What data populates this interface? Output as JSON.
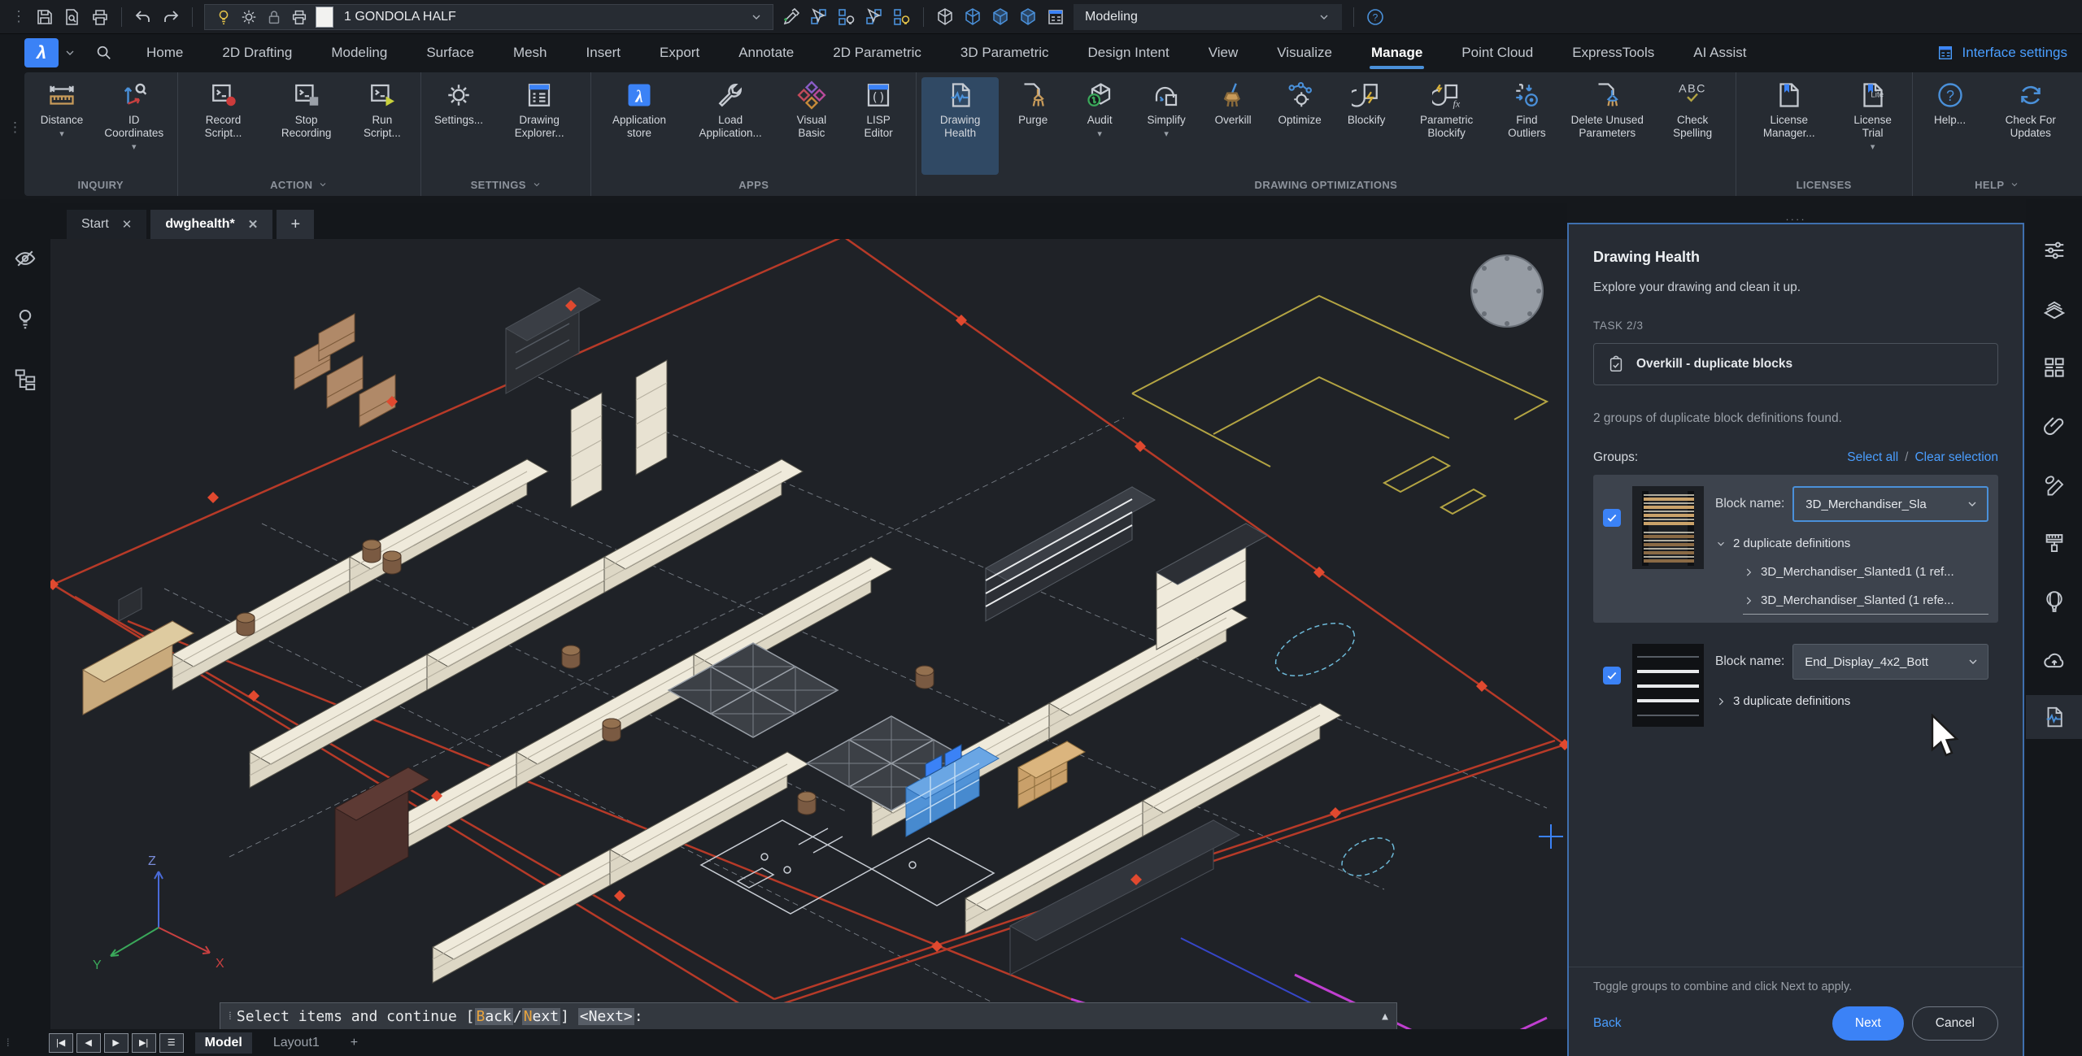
{
  "topbar": {
    "drawing_selector": {
      "value": "1 GONDOLA HALF"
    },
    "workspace_selector": {
      "value": "Modeling"
    },
    "icons": [
      "save-icon",
      "file-search-icon",
      "plot-icon",
      "undo-icon",
      "redo-icon",
      "bulb-icon",
      "sun-icon",
      "lock-icon",
      "printer-icon",
      "color-swatch",
      "eyedropper-icon",
      "select-similar-icon",
      "isolate-objects-icon",
      "deselect-icon",
      "unisolate-objects-icon",
      "wireframe-cube-icon",
      "hidden-cube-icon",
      "shaded-cube-icon",
      "realistic-cube-icon",
      "workspace-icon",
      "help-icon"
    ]
  },
  "tab_row": {
    "tabs": [
      "Home",
      "2D Drafting",
      "Modeling",
      "Surface",
      "Mesh",
      "Insert",
      "Export",
      "Annotate",
      "2D Parametric",
      "3D Parametric",
      "Design Intent",
      "View",
      "Visualize",
      "Manage",
      "Point Cloud",
      "ExpressTools",
      "AI Assist"
    ],
    "active_tab": "Manage",
    "interface_settings_label": "Interface settings"
  },
  "ribbon": {
    "groups": [
      {
        "label": "INQUIRY",
        "chevron": false,
        "items": [
          {
            "label": "Distance",
            "dropdown": true
          },
          {
            "label": "ID Coordinates",
            "dropdown": true
          }
        ]
      },
      {
        "label": "ACTION",
        "chevron": true,
        "items": [
          {
            "label": "Record Script..."
          },
          {
            "label": "Stop Recording"
          },
          {
            "label": "Run Script..."
          }
        ]
      },
      {
        "label": "SETTINGS",
        "chevron": true,
        "items": [
          {
            "label": "Settings..."
          },
          {
            "label": "Drawing Explorer..."
          }
        ]
      },
      {
        "label": "APPS",
        "chevron": false,
        "items": [
          {
            "label": "Application store"
          },
          {
            "label": "Load Application..."
          },
          {
            "label": "Visual Basic"
          },
          {
            "label": "LISP Editor"
          }
        ]
      },
      {
        "label": "DRAWING OPTIMIZATIONS",
        "chevron": false,
        "items": [
          {
            "label": "Drawing Health",
            "active": true
          },
          {
            "label": "Purge"
          },
          {
            "label": "Audit",
            "dropdown": true
          },
          {
            "label": "Simplify",
            "dropdown": true
          },
          {
            "label": "Overkill"
          },
          {
            "label": "Optimize"
          },
          {
            "label": "Blockify"
          },
          {
            "label": "Parametric Blockify"
          },
          {
            "label": "Find Outliers"
          },
          {
            "label": "Delete Unused Parameters"
          },
          {
            "label": "Check Spelling"
          }
        ]
      },
      {
        "label": "LICENSES",
        "chevron": false,
        "items": [
          {
            "label": "License Manager..."
          },
          {
            "label": "License Trial",
            "dropdown": true
          }
        ]
      },
      {
        "label": "HELP",
        "chevron": true,
        "items": [
          {
            "label": "Help..."
          },
          {
            "label": "Check For Updates"
          }
        ]
      }
    ]
  },
  "doc_tabs": {
    "tabs": [
      {
        "label": "Start"
      },
      {
        "label": "dwghealth*",
        "active": true
      }
    ],
    "close_glyph": "✕",
    "new_tab": "+"
  },
  "left_sidebar": {
    "icons": [
      "hide-objects-icon",
      "light-bulb-icon",
      "structure-tree-icon"
    ]
  },
  "right_sidebar": {
    "icons": [
      "properties-sliders-icon",
      "layers-icon",
      "blocks-grid-icon",
      "attachments-paperclip-icon",
      "sheets-render-icon",
      "hatch-paint-icon",
      "render-balloon-icon",
      "cloud-upload-icon",
      "drawing-health-icon"
    ],
    "active": "drawing-health-icon"
  },
  "panel": {
    "title": "Drawing Health",
    "subtitle": "Explore your drawing and clean it up.",
    "task_label": "TASK 2/3",
    "task_name": "Overkill - duplicate blocks",
    "found_text": "2 groups of duplicate block definitions found.",
    "groups_label": "Groups:",
    "select_all": "Select all",
    "separator": "/",
    "clear_selection": "Clear selection",
    "block_name_label": "Block name:",
    "groups": [
      {
        "block_name": "3D_Merchandiser_Sla",
        "dupes": "2 duplicate definitions",
        "children": [
          "3D_Merchandiser_Slanted1 (1 ref...",
          "3D_Merchandiser_Slanted (1 refe..."
        ],
        "checked": true
      },
      {
        "block_name": "End_Display_4x2_Bott",
        "dupes": "3 duplicate definitions",
        "checked": true
      }
    ],
    "footer_hint": "Toggle groups to combine and click Next to apply.",
    "back": "Back",
    "next": "Next",
    "cancel": "Cancel",
    "accent_color": "#3b82f6",
    "link_color": "#4a9eff"
  },
  "command_bar": {
    "prefix": "Select items and continue [",
    "back_hot": "B",
    "back_rest": "ack",
    "slash": "/",
    "next_hot": "N",
    "next_rest": "ext",
    "bracket_close": "] ",
    "default_option": "<Next>",
    "colon": ":",
    "collapse_caret": "▲"
  },
  "status_bar": {
    "nav": [
      "|◀",
      "◀",
      "▶",
      "▶|"
    ],
    "list_icon": "layout-list-icon",
    "model_tab": "Model",
    "layout_tab": "Layout1",
    "new_layout": "+"
  },
  "canvas": {
    "ucs": {
      "x": "X",
      "y": "Y",
      "z": "Z"
    }
  }
}
